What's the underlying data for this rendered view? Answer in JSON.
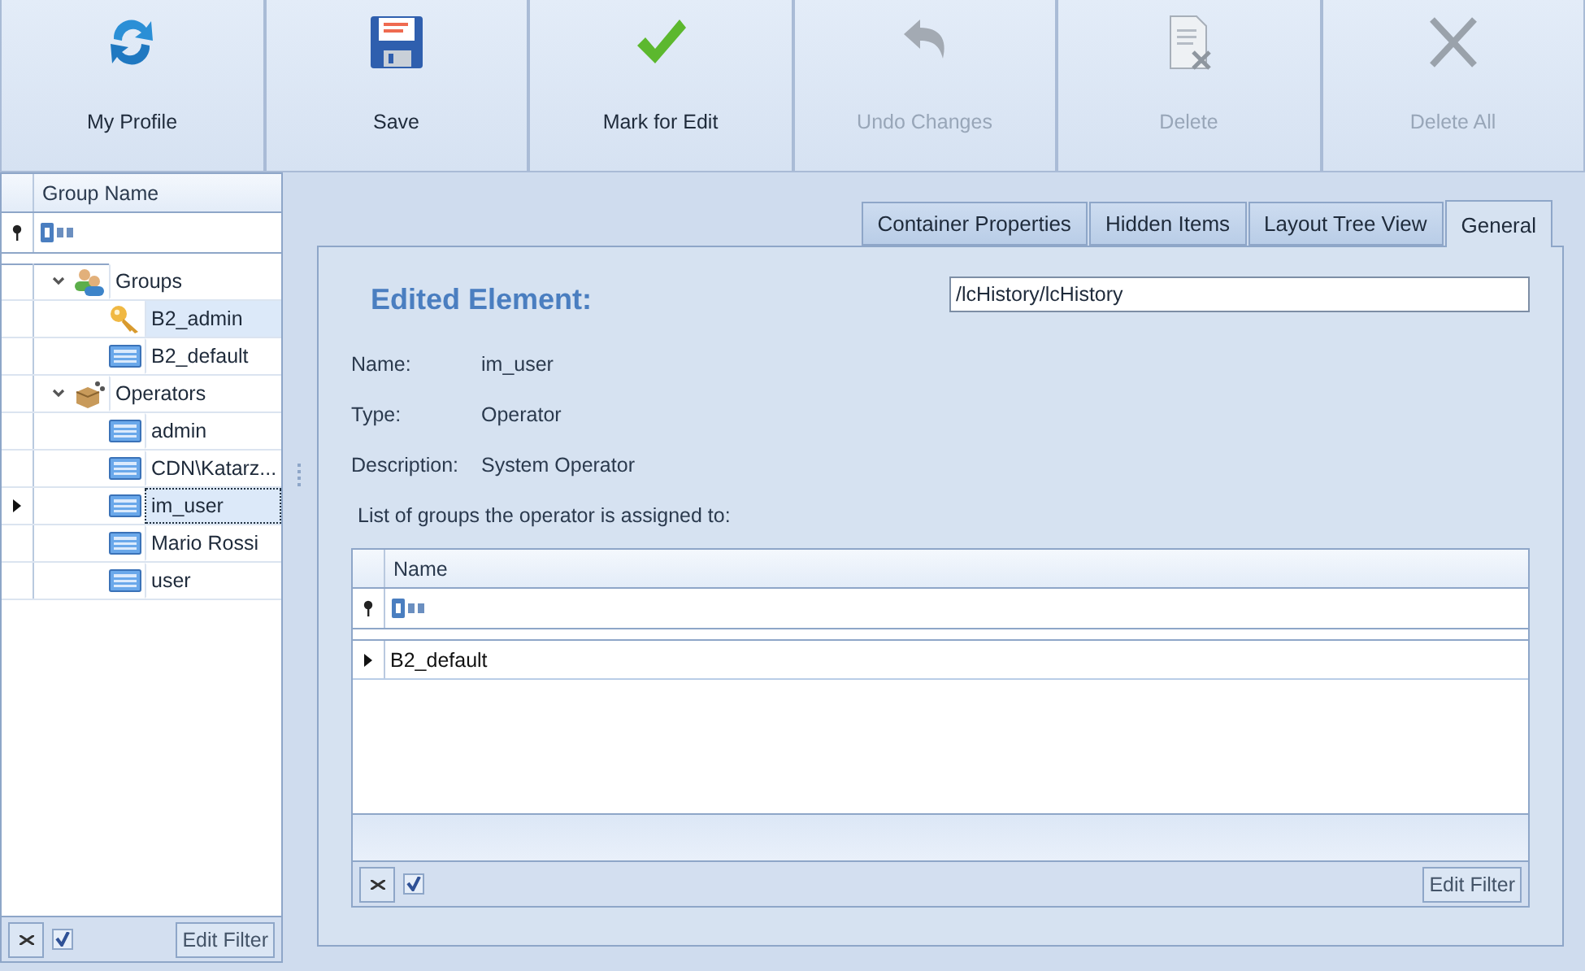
{
  "toolbar": [
    {
      "label": "My Profile",
      "kind": "refresh",
      "disabled": false
    },
    {
      "label": "Save",
      "kind": "save",
      "disabled": false
    },
    {
      "label": "Mark for Edit",
      "kind": "check",
      "disabled": false
    },
    {
      "label": "Undo Changes",
      "kind": "undo",
      "disabled": true
    },
    {
      "label": "Delete",
      "kind": "doc-delete",
      "disabled": true
    },
    {
      "label": "Delete All",
      "kind": "cross",
      "disabled": true
    }
  ],
  "tree_grid": {
    "column": "Group Name",
    "items": [
      {
        "label": "Groups",
        "kind": "users",
        "expanded": true,
        "selected": false,
        "focused": false,
        "children": [
          {
            "label": "B2_admin",
            "kind": "key",
            "selected": true,
            "focused": false
          },
          {
            "label": "B2_default",
            "kind": "record",
            "selected": false,
            "focused": false
          }
        ]
      },
      {
        "label": "Operators",
        "kind": "box",
        "expanded": true,
        "selected": false,
        "focused": false,
        "children": [
          {
            "label": "admin",
            "kind": "record",
            "selected": false,
            "focused": false
          },
          {
            "label": "CDN\\Katarz...",
            "kind": "record",
            "selected": false,
            "focused": false
          },
          {
            "label": "im_user",
            "kind": "record",
            "selected": true,
            "focused": true
          },
          {
            "label": "Mario Rossi",
            "kind": "record",
            "selected": false,
            "focused": false
          },
          {
            "label": "user",
            "kind": "record",
            "selected": false,
            "focused": false
          }
        ]
      }
    ],
    "filter": {
      "checked": true,
      "button": "Edit Filter"
    }
  },
  "tabs": [
    {
      "label": "Container Properties",
      "selected": false
    },
    {
      "label": "Hidden Items",
      "selected": false
    },
    {
      "label": "Layout Tree View",
      "selected": false
    },
    {
      "label": "General",
      "selected": true
    }
  ],
  "edited_element": {
    "title": "Edited Element:",
    "path": "/lcHistory/lcHistory"
  },
  "fields": [
    {
      "label": "Name:",
      "value": "im_user"
    },
    {
      "label": "Type:",
      "value": "Operator"
    },
    {
      "label": "Description:",
      "value": "System Operator"
    }
  ],
  "groups_list": {
    "caption": "List of groups the operator is assigned to:",
    "column": "Name",
    "rows": [
      {
        "name": "B2_default",
        "selected": true
      }
    ],
    "filter": {
      "checked": true,
      "button": "Edit Filter"
    }
  }
}
